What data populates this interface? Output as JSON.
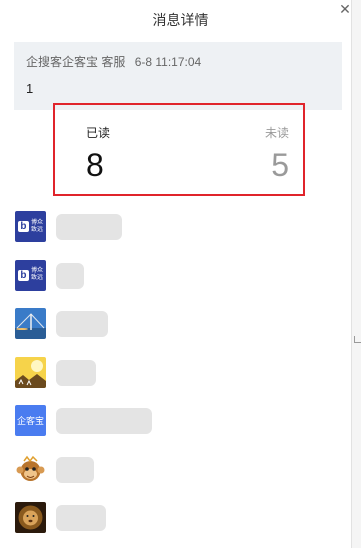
{
  "dialog": {
    "title": "消息详情",
    "close_glyph": "✕"
  },
  "message": {
    "sender": "企搜客企客宝 客服",
    "time": "6-8 11:17:04",
    "content": "1"
  },
  "stats": {
    "read": {
      "label": "已读",
      "count": "8",
      "color": "#111111"
    },
    "unread": {
      "label": "未读",
      "count": "5",
      "color": "#9a9a9a"
    },
    "highlight_color": "#e0242b"
  },
  "readers": [
    {
      "avatar": "bozhong-logo",
      "avatar_text": "博众\n致远"
    },
    {
      "avatar": "bozhong-logo",
      "avatar_text": "博众\n致远"
    },
    {
      "avatar": "bridge-photo"
    },
    {
      "avatar": "sunshine-photo"
    },
    {
      "avatar": "qikebao-logo",
      "avatar_text": "企客宝"
    },
    {
      "avatar": "monkey-cartoon"
    },
    {
      "avatar": "lion-photo"
    }
  ]
}
